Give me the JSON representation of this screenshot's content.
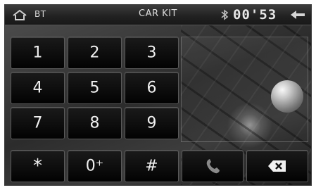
{
  "statusbar": {
    "source": "BT",
    "title": "CAR KIT",
    "clock": "00'53",
    "home_icon": "home-icon",
    "bluetooth_icon": "bluetooth-icon",
    "back_icon": "back-arrow-icon"
  },
  "keypad": {
    "keys": [
      "1",
      "2",
      "3",
      "4",
      "5",
      "6",
      "7",
      "8",
      "9",
      "*",
      "0⁺",
      "#"
    ]
  },
  "actions": {
    "call_icon": "phone-handset-icon",
    "delete_icon": "backspace-icon"
  }
}
